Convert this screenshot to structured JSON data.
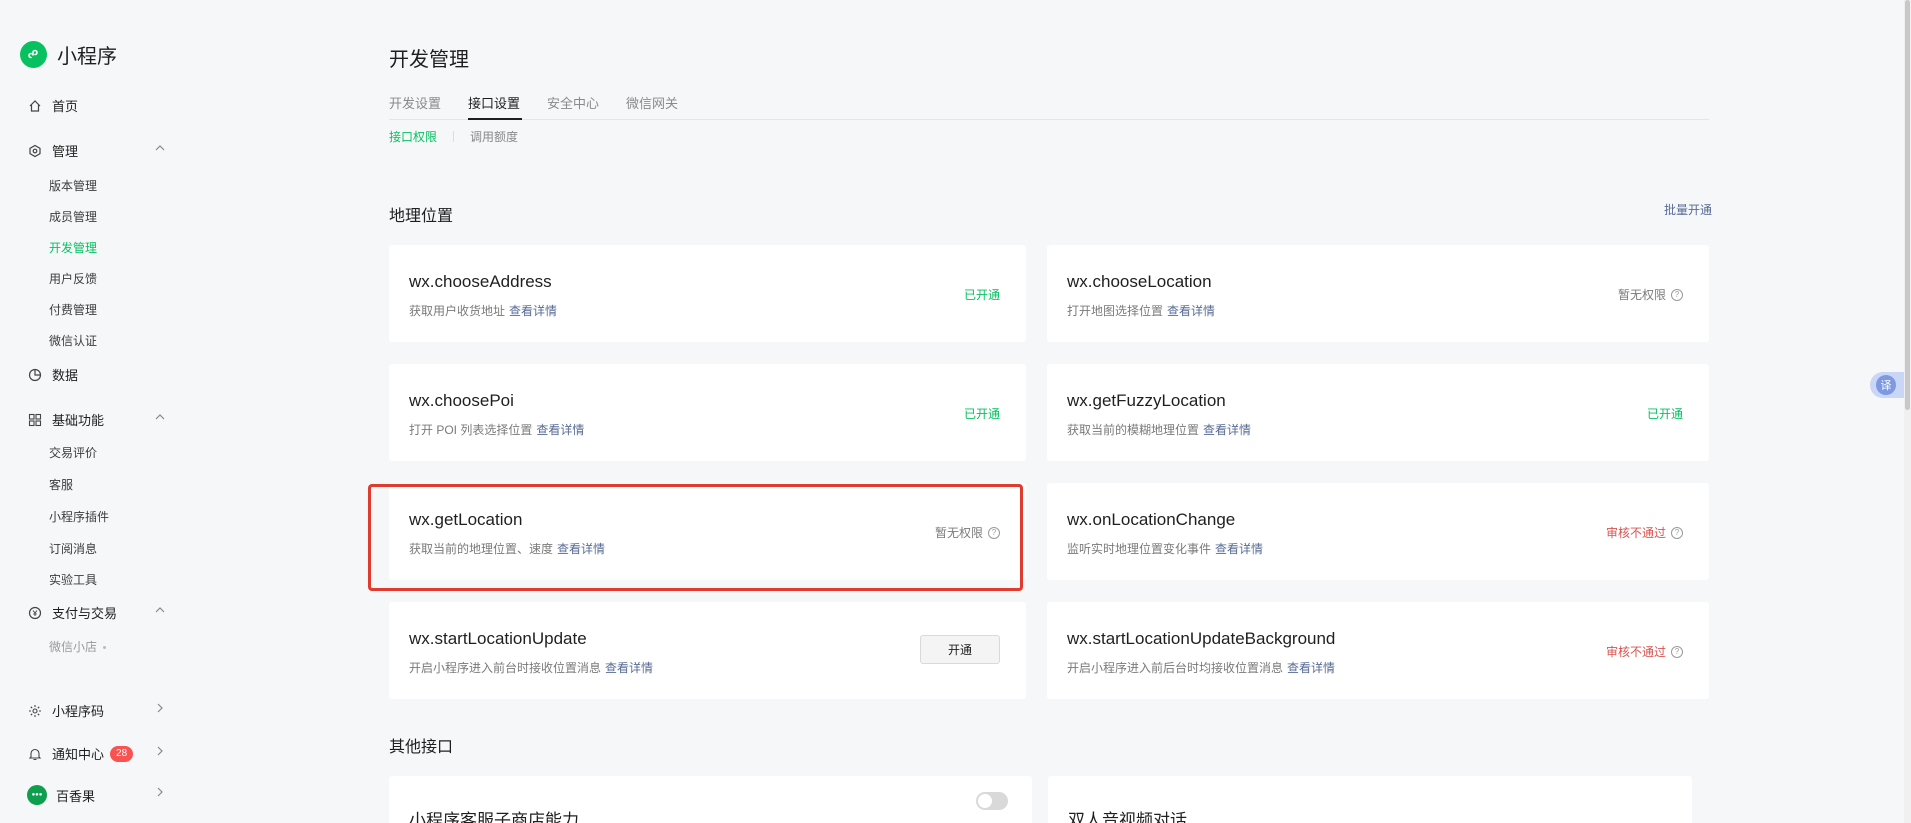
{
  "brand": {
    "name": "小程序",
    "logo_icon": "miniprogram-logo-icon",
    "color": "#07c160"
  },
  "sidebar": {
    "home": "首页",
    "manage": {
      "label": "管理",
      "items": [
        "版本管理",
        "成员管理",
        "开发管理",
        "用户反馈",
        "付费管理",
        "微信认证"
      ]
    },
    "data": "数据",
    "basic": {
      "label": "基础功能",
      "items": [
        "交易评价",
        "客服",
        "小程序插件",
        "订阅消息",
        "实验工具"
      ]
    },
    "payment": {
      "label": "支付与交易",
      "items": [
        "微信小店"
      ]
    },
    "qrcode": "小程序码",
    "notify": {
      "label": "通知中心",
      "badge": "28"
    },
    "account": {
      "label": "百香果"
    }
  },
  "page": {
    "title": "开发管理",
    "tabs": [
      "开发设置",
      "接口设置",
      "安全中心",
      "微信网关"
    ],
    "active_tab": "接口设置",
    "subtabs": [
      "接口权限",
      "调用额度"
    ]
  },
  "sections": {
    "geo": {
      "title": "地理位置",
      "batch_link": "批量开通"
    },
    "other": {
      "title": "其他接口"
    }
  },
  "detail_link": "查看详情",
  "status_labels": {
    "opened": "已开通",
    "no_permission": "暂无权限",
    "rejected": "审核不通过",
    "open_button": "开通"
  },
  "cards": [
    {
      "name": "wx.chooseAddress",
      "desc": "获取用户收货地址"
    },
    {
      "name": "wx.chooseLocation",
      "desc": "打开地图选择位置"
    },
    {
      "name": "wx.choosePoi",
      "desc": "打开 POI 列表选择位置"
    },
    {
      "name": "wx.getFuzzyLocation",
      "desc": "获取当前的模糊地理位置"
    },
    {
      "name": "wx.getLocation",
      "desc": "获取当前的地理位置、速度"
    },
    {
      "name": "wx.onLocationChange",
      "desc": "监听实时地理位置变化事件"
    },
    {
      "name": "wx.startLocationUpdate",
      "desc": "开启小程序进入前台时接收位置消息"
    },
    {
      "name": "wx.startLocationUpdateBackground",
      "desc": "开启小程序进入前后台时均接收位置消息"
    }
  ],
  "other_cards": [
    {
      "name": "小程序客服子商店能力"
    },
    {
      "name": "双人音视频对话"
    }
  ],
  "translate": "译",
  "colors": {
    "accent": "#07c160",
    "link": "#576b95",
    "danger": "#d9534f",
    "highlight": "#e03b2f"
  }
}
